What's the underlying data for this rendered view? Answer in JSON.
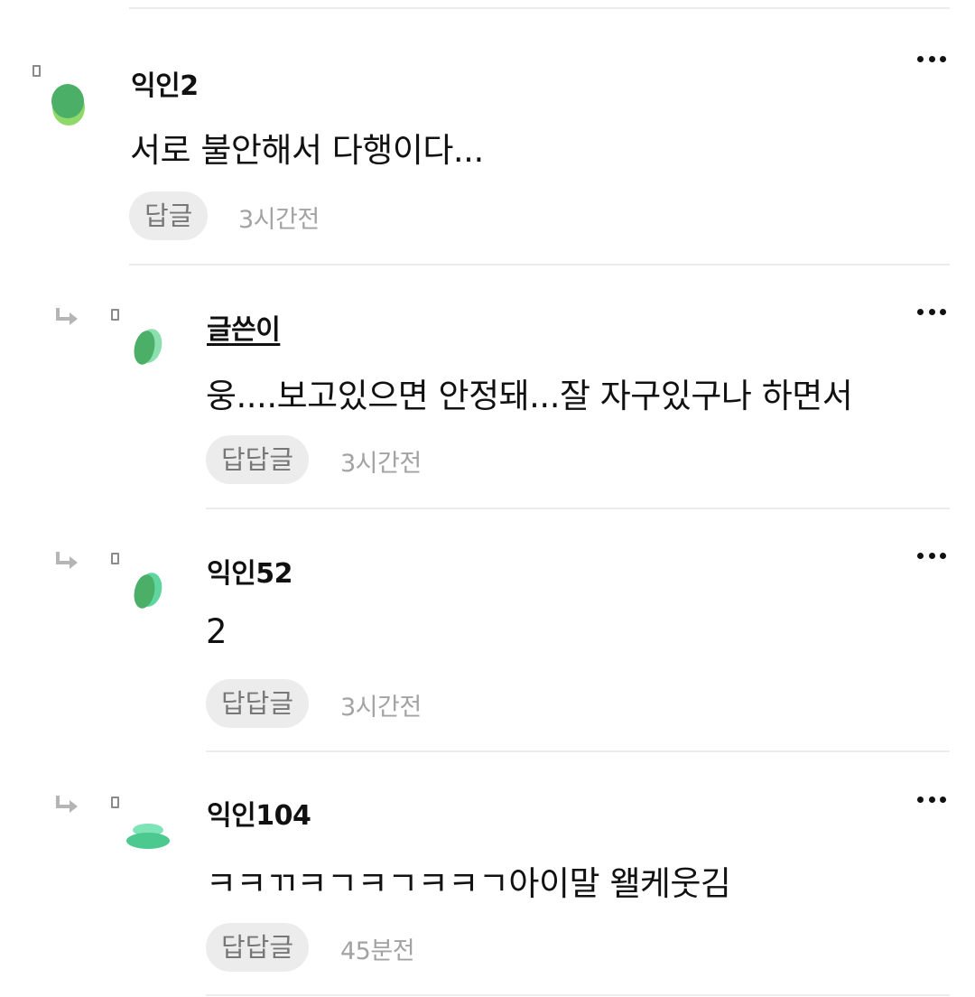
{
  "comments": [
    {
      "author": "익인2",
      "text": "서로 불안해서 다행이다...",
      "reply_label": "답글",
      "time": "3시간전",
      "is_reply": false,
      "is_op": false
    },
    {
      "author": "글쓴이",
      "text": "웅....보고있으면 안정돼...잘 자구있구나 하면서",
      "reply_label": "답답글",
      "time": "3시간전",
      "is_reply": true,
      "is_op": true
    },
    {
      "author": "익인52",
      "text": "2",
      "reply_label": "답답글",
      "time": "3시간전",
      "is_reply": true,
      "is_op": false
    },
    {
      "author": "익인104",
      "text": "ㅋㅋㄲㅋㄱㅋㄱㅋㅋㄱ아이말 왤케웃김",
      "reply_label": "답답글",
      "time": "45분전",
      "is_reply": true,
      "is_op": false
    }
  ],
  "icons": {
    "more": "more-horizontal-icon",
    "reply_arrow": "reply-arrow-icon",
    "badge": "user-badge-icon"
  },
  "colors": {
    "avatar_green_dark": "#4caf68",
    "avatar_green_light": "#8fd86a",
    "avatar_mint": "#5fd6a0",
    "reply_button_bg": "#ececec",
    "divider": "#ececec",
    "time_text": "#a3a3a3"
  }
}
